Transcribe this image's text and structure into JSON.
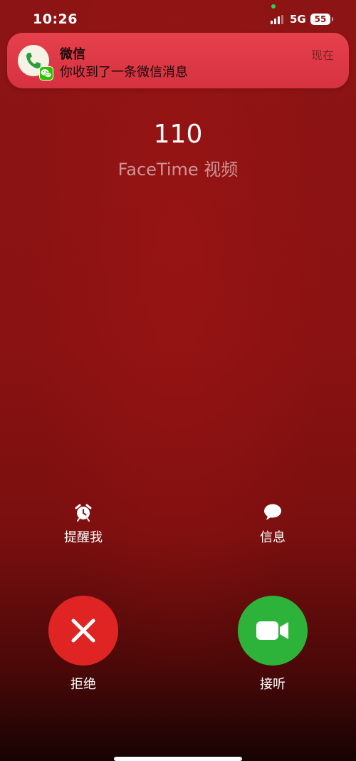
{
  "status_bar": {
    "time": "10:26",
    "network": "5G",
    "battery": "55"
  },
  "notification": {
    "app_name": "微信",
    "message": "你收到了一条微信消息",
    "time": "现在",
    "icon": "phone-icon",
    "badge_icon": "wechat-icon"
  },
  "call": {
    "number": "110",
    "type": "FaceTime 视频"
  },
  "actions": {
    "remind_label": "提醒我",
    "remind_icon": "alarm-clock-icon",
    "message_label": "信息",
    "message_icon": "speech-bubble-icon"
  },
  "buttons": {
    "decline_label": "拒绝",
    "decline_icon": "x-icon",
    "accept_label": "接听",
    "accept_icon": "video-camera-icon"
  },
  "colors": {
    "background": "#8d1414",
    "decline": "#e02424",
    "accept": "#2db33a",
    "notification": "#e03d4a",
    "wechat_green": "#2dc100"
  }
}
